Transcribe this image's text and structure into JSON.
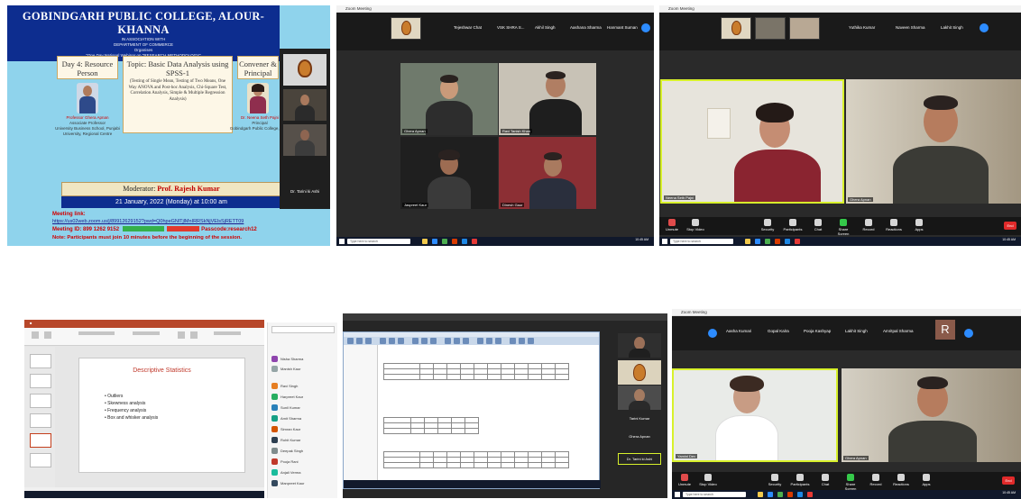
{
  "poster": {
    "title": "GOBINDGARH PUBLIC COLLEGE, ALOUR- KHANNA",
    "sub1": "IN ASSOCIATION WITH",
    "sub2": "DEPARTMENT OF COMMERCE",
    "sub3": "Organises",
    "sub4": "\"One Day National Webinar on \"RESEARCH METHODOLOGY\"",
    "resource_heading": "Day 4: Resource Person",
    "topic_heading": "Topic: Basic Data Analysis using SPSS-1",
    "topic_text": "(Testing of Single Mean, Testing of Two Means, One Way ANOVA and Post-hoc Analysis, Chi-Square Test, Correlation Analysis, Simple & Multiple Regression Analysis)",
    "convener_heading": "Convener & Principal",
    "resource_name": "Professor Ghera Apnan",
    "resource_role": "Associate Professor",
    "resource_org": "University Business School, Punjabi University, Regional Centre",
    "convener_name": "Dr. Neena Seth Pajni",
    "convener_role": "Principal",
    "convener_org": "Gobindgarh Public College, Alour",
    "moderator_label": "Moderator:",
    "moderator_name": "Prof. Rajesh Kumar",
    "date": "21 January, 2022 (Monday) at 10:00 am",
    "meeting_link_label": "Meeting link:",
    "meeting_link": "https://us02web.zoom.us/j/89912629152?pwd=Q0hpeGNlTjlMnIRRSkNjVElsSjRETT09",
    "meeting_id": "Meeting ID: 899 1262 9152",
    "passcode": "Passcode:research12",
    "note": "Note: Participants must join 10 minutes before the beginning of the session.",
    "side_name": "Dr. Tarini ki Ashi"
  },
  "zoom1": {
    "window_title": "Zoom Meeting",
    "participants": [
      "Tejeshwar Chat",
      "VSK SHRA S...",
      "Akhil Singh",
      "Aashana Sharma",
      "Hanmant Suman"
    ],
    "videos": [
      "Ghera Apnan",
      "Ravi Tanish Khan",
      "Jaspreet Kaur",
      "Dinesh Gaur"
    ]
  },
  "zoom2": {
    "window_title": "Zoom Meeting",
    "participants": [
      "Yuthika Kumar",
      "Naveen Sharma",
      "Lakhit Singh"
    ],
    "videos": [
      "Neena Seth Pajni",
      "Ghera Apnan"
    ],
    "controls": [
      "Unmute",
      "Stop Video",
      "Security",
      "Participants",
      "Chat",
      "Share Screen",
      "Record",
      "Reactions",
      "Apps",
      "End"
    ],
    "search_placeholder": "Type here to search",
    "time": "10:45 AM"
  },
  "ppt": {
    "slide_title": "Descriptive Statistics",
    "bullets": [
      "Outliers",
      "Skewness analysis",
      "Frequency analysis",
      "Box and whisker analysis"
    ],
    "chat_items": [
      "Nisha Sharma",
      "Manish Kaur",
      "Ravi Singh",
      "Harpreet Kaur",
      "Sunil Kumar",
      "Amit Sharma",
      "Simran Kaur",
      "Rohit Kumar",
      "Deepak Singh",
      "Pooja Rani",
      "Anjali Verma",
      "Manpreet Kaur"
    ]
  },
  "spss": {
    "side_names": [
      "Tarini Kumar",
      "Ghera Apnan",
      "Dr. Tarini ki Ashi"
    ]
  },
  "zoom3": {
    "participants": [
      "Aasha Kumari",
      "Gopal Kalra",
      "Pooja Kashyap",
      "Lakhit Singh",
      "Amritpal Sharma"
    ],
    "avatar_letter": "R",
    "videos": [
      "Yamini Dev",
      "Ghera Apnan"
    ]
  }
}
